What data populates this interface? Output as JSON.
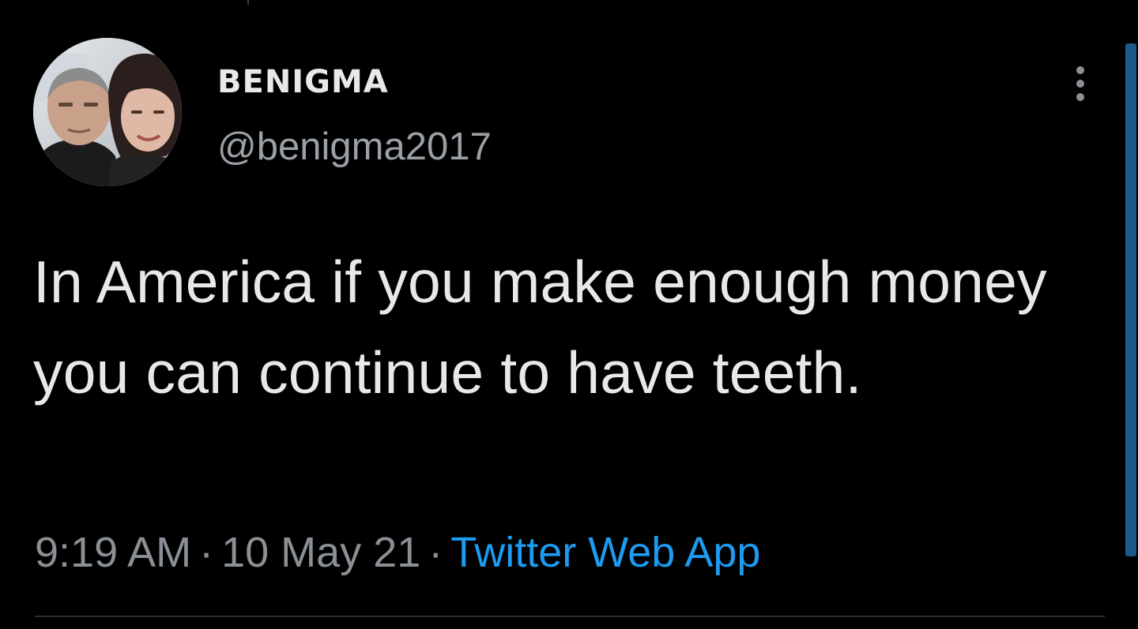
{
  "tweet": {
    "author": {
      "display_name": "BENIGMA",
      "handle": "@benigma2017"
    },
    "text": "In America if you make enough money you can continue to have teeth.",
    "time": "9:19 AM",
    "date": "10 May 21",
    "separator": "·",
    "source": "Twitter Web App"
  },
  "colors": {
    "background": "#000000",
    "primary_text": "#e7e9ea",
    "secondary_text": "#8b9096",
    "link": "#1d9bf0",
    "scrollbar": "#1d5a8a"
  },
  "icons": {
    "more": "more-vertical-icon"
  }
}
